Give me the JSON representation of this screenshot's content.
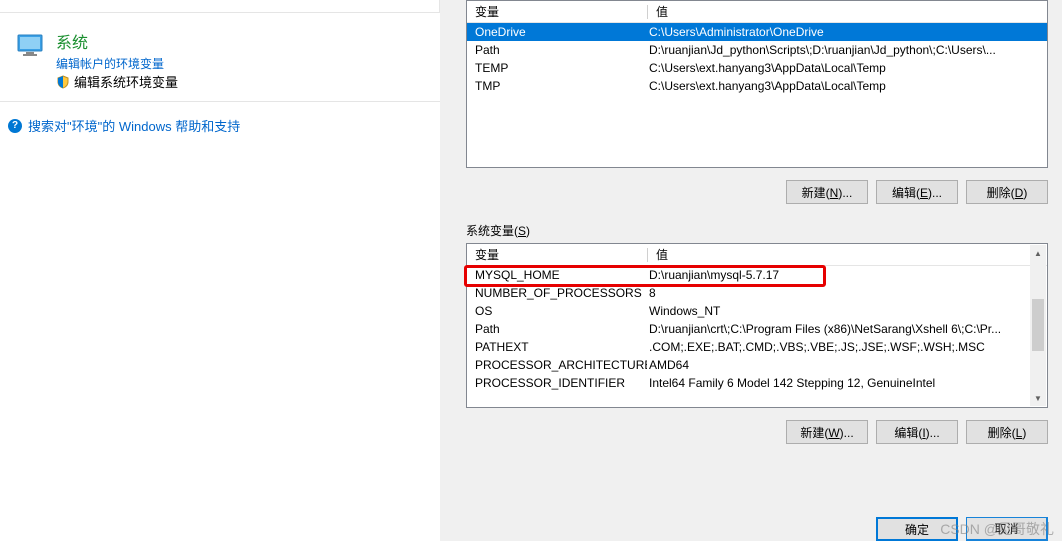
{
  "left": {
    "sys_title": "系统",
    "edit_account_link": "编辑帐户的环境变量",
    "edit_sys_link": "编辑系统环境变量",
    "help_text": "搜索对\"环境\"的 Windows 帮助和支持"
  },
  "headers": {
    "variable": "变量",
    "value": "值"
  },
  "user_vars": [
    {
      "name": "OneDrive",
      "value": "C:\\Users\\Administrator\\OneDrive",
      "selected": true
    },
    {
      "name": "Path",
      "value": "D:\\ruanjian\\Jd_python\\Scripts\\;D:\\ruanjian\\Jd_python\\;C:\\Users\\..."
    },
    {
      "name": "TEMP",
      "value": "C:\\Users\\ext.hanyang3\\AppData\\Local\\Temp"
    },
    {
      "name": "TMP",
      "value": "C:\\Users\\ext.hanyang3\\AppData\\Local\\Temp"
    }
  ],
  "sys_section_label": "系统变量(S)",
  "sys_vars": [
    {
      "name": "MYSQL_HOME",
      "value": "D:\\ruanjian\\mysql-5.7.17"
    },
    {
      "name": "NUMBER_OF_PROCESSORS",
      "value": "8"
    },
    {
      "name": "OS",
      "value": "Windows_NT"
    },
    {
      "name": "Path",
      "value": "D:\\ruanjian\\crt\\;C:\\Program Files (x86)\\NetSarang\\Xshell 6\\;C:\\Pr..."
    },
    {
      "name": "PATHEXT",
      "value": ".COM;.EXE;.BAT;.CMD;.VBS;.VBE;.JS;.JSE;.WSF;.WSH;.MSC"
    },
    {
      "name": "PROCESSOR_ARCHITECTURE",
      "value": "AMD64"
    },
    {
      "name": "PROCESSOR_IDENTIFIER",
      "value": "Intel64 Family 6 Model 142 Stepping 12, GenuineIntel"
    }
  ],
  "buttons": {
    "new_n": "新建(N)...",
    "edit_e": "编辑(E)...",
    "delete_d": "删除(D)",
    "new_w": "新建(W)...",
    "edit_i": "编辑(I)...",
    "delete_l": "删除(L)",
    "ok": "确定",
    "cancel": "取消"
  },
  "watermark": "CSDN @见哥敬礼"
}
